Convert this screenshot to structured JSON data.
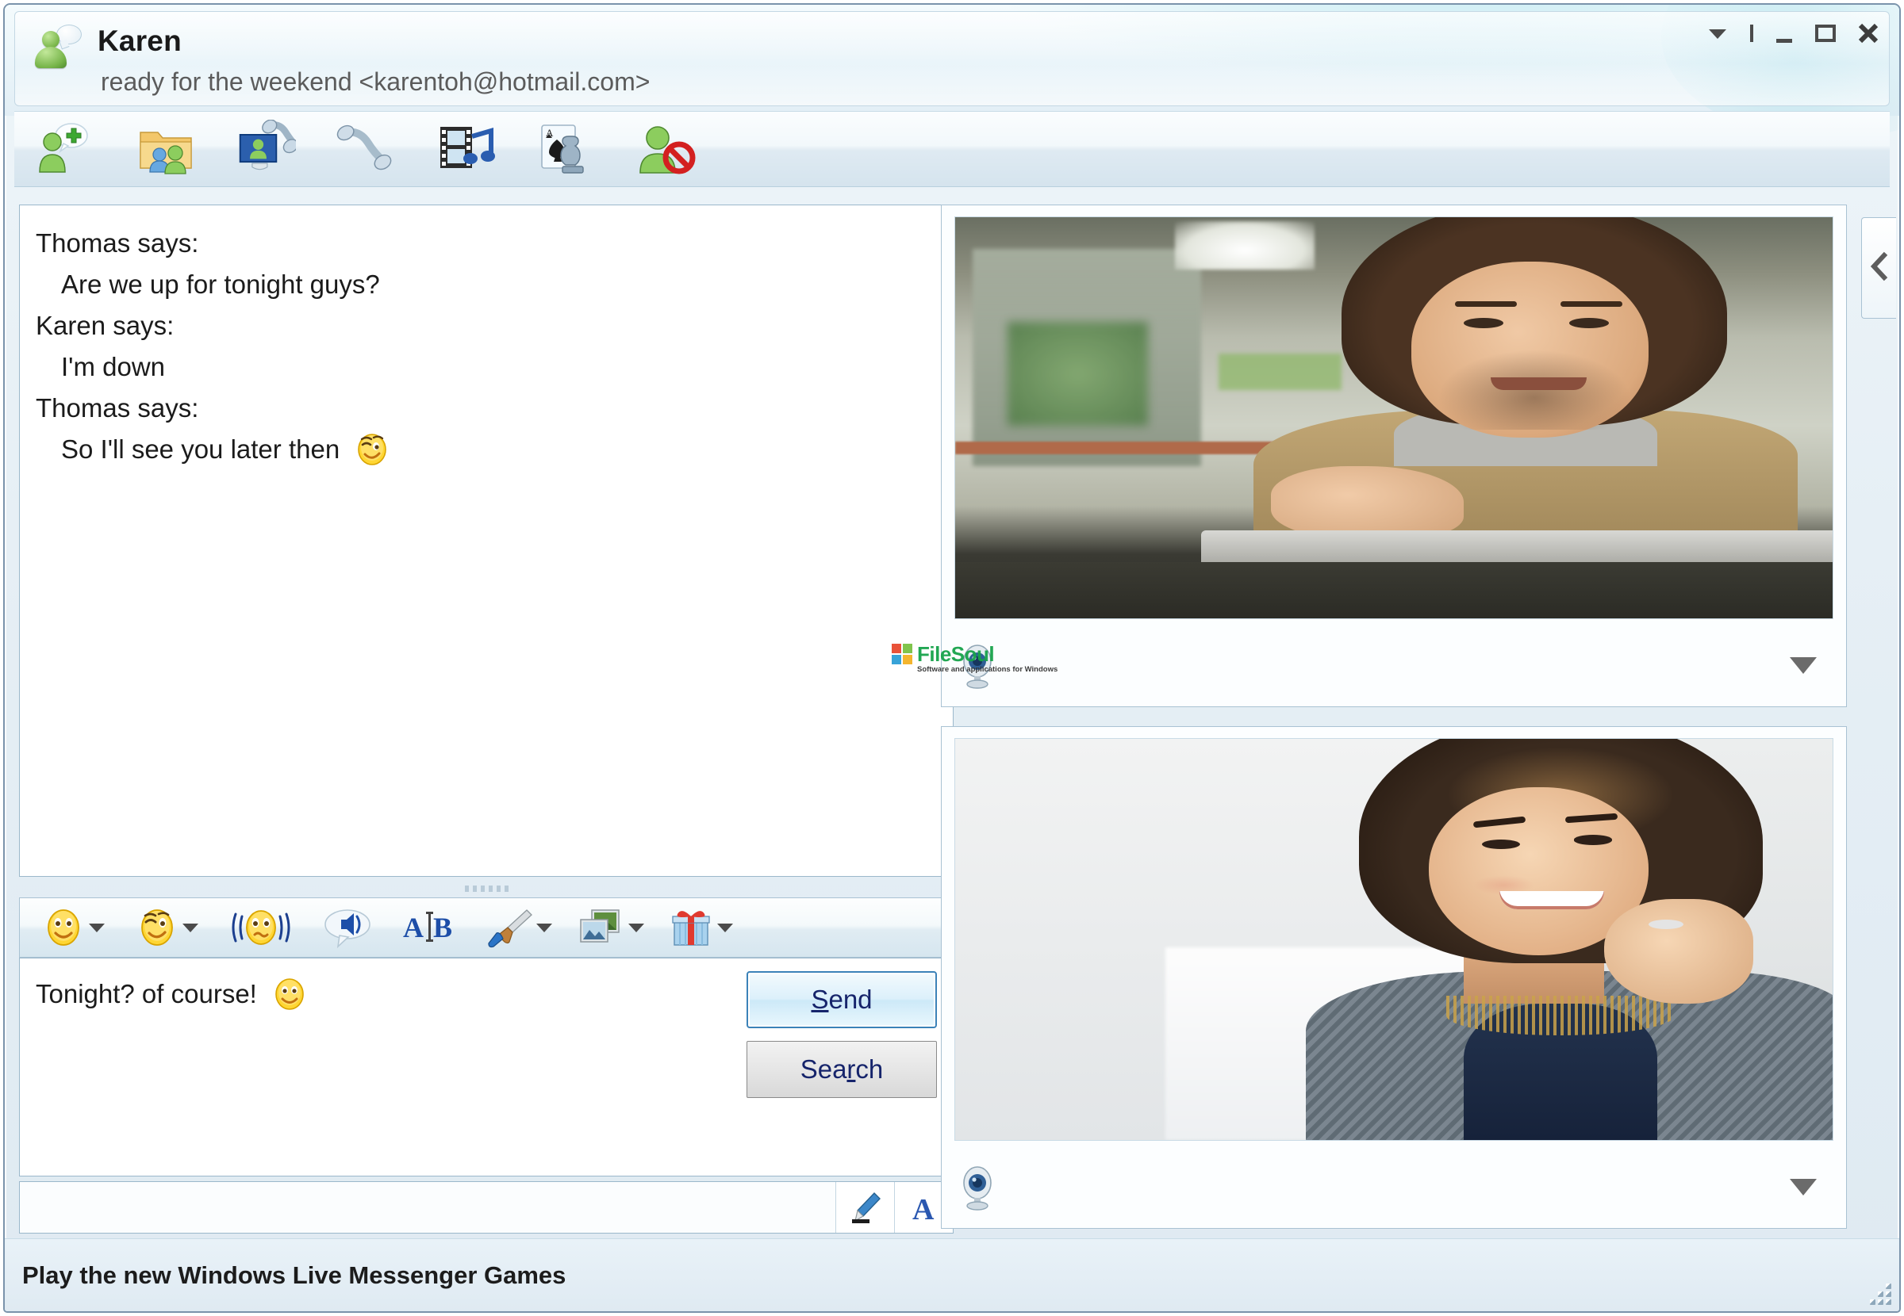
{
  "window": {
    "controls": [
      {
        "name": "menu-chevron",
        "glyph": "chevron-down-icon"
      },
      {
        "name": "separator",
        "glyph": "bar-icon"
      },
      {
        "name": "minimize",
        "glyph": "minimize-icon"
      },
      {
        "name": "maximize",
        "glyph": "maximize-icon"
      },
      {
        "name": "close",
        "glyph": "close-icon"
      }
    ]
  },
  "header": {
    "contact_name": "Karen",
    "status_line": "ready for the weekend <karentoh@hotmail.com>",
    "avatar_icon": "contact-avatar-icon"
  },
  "toolbar": {
    "buttons": [
      {
        "name": "invite-contact",
        "label": "Invite someone to this conversation",
        "icon": "person-add-icon"
      },
      {
        "name": "share-files",
        "label": "Share files",
        "icon": "shared-folder-icon"
      },
      {
        "name": "video-call",
        "label": "Video call",
        "icon": "video-call-icon"
      },
      {
        "name": "voice-call",
        "label": "Voice call",
        "icon": "phone-call-icon"
      },
      {
        "name": "share-media",
        "label": "Share photos and media",
        "icon": "film-music-icon"
      },
      {
        "name": "play-game",
        "label": "Play a game",
        "icon": "games-card-chess-icon"
      },
      {
        "name": "block-contact",
        "label": "Block contact",
        "icon": "person-block-icon"
      }
    ]
  },
  "conversation": {
    "messages": [
      {
        "speaker": "Thomas says:",
        "text": "Are we up for tonight guys?",
        "emoticon": ""
      },
      {
        "speaker": "Karen says:",
        "text": "I'm down",
        "emoticon": ""
      },
      {
        "speaker": "Thomas says:",
        "text": "So I'll see you later then",
        "emoticon": "wink-smiley-icon"
      }
    ]
  },
  "format_bar": {
    "buttons": [
      {
        "name": "emoticons",
        "icon": "smiley-icon",
        "has_caret": true
      },
      {
        "name": "winks",
        "icon": "wink-smiley-icon",
        "has_caret": true
      },
      {
        "name": "nudge",
        "icon": "nudge-icon",
        "has_caret": false
      },
      {
        "name": "sound",
        "icon": "sound-bubble-icon",
        "has_caret": false
      },
      {
        "name": "change-font",
        "icon": "font-ab-icon",
        "has_caret": false
      },
      {
        "name": "background",
        "icon": "paintbrush-icon",
        "has_caret": true
      },
      {
        "name": "photo-sharing",
        "icon": "photos-icon",
        "has_caret": true
      },
      {
        "name": "gift",
        "icon": "gift-icon",
        "has_caret": true
      }
    ]
  },
  "compose": {
    "message_value": "Tonight? of course!",
    "message_emoticon": "smiley-icon",
    "send_label_before": "S",
    "send_label_after": "end",
    "search_label_before": "Sea",
    "search_label_mid": "r",
    "search_label_after": "ch",
    "bottom_buttons": [
      {
        "name": "handwriting",
        "icon": "pen-icon"
      },
      {
        "name": "text-mode",
        "icon": "letter-a-icon"
      }
    ]
  },
  "video": {
    "panels": [
      {
        "name": "remote-video",
        "camera_icon": "webcam-icon",
        "caret_icon": "chevron-down-icon"
      },
      {
        "name": "local-video",
        "camera_icon": "webcam-icon",
        "caret_icon": "chevron-down-icon"
      }
    ],
    "side_tab_icon": "chevron-left-icon"
  },
  "watermark": {
    "title_file": "File",
    "title_soul": "Soul",
    "subtitle": "Software and applications for Windows",
    "colors": [
      "#e8492f",
      "#7ac143",
      "#2e9fd6",
      "#f4b223"
    ]
  },
  "statusbar": {
    "promo": "Play the new Windows Live Messenger Games"
  },
  "colors": {
    "frame_border": "#7a93ab",
    "accent_blue": "#3b82b8",
    "button_text": "#16246b",
    "brand_green": "#17a34a"
  }
}
